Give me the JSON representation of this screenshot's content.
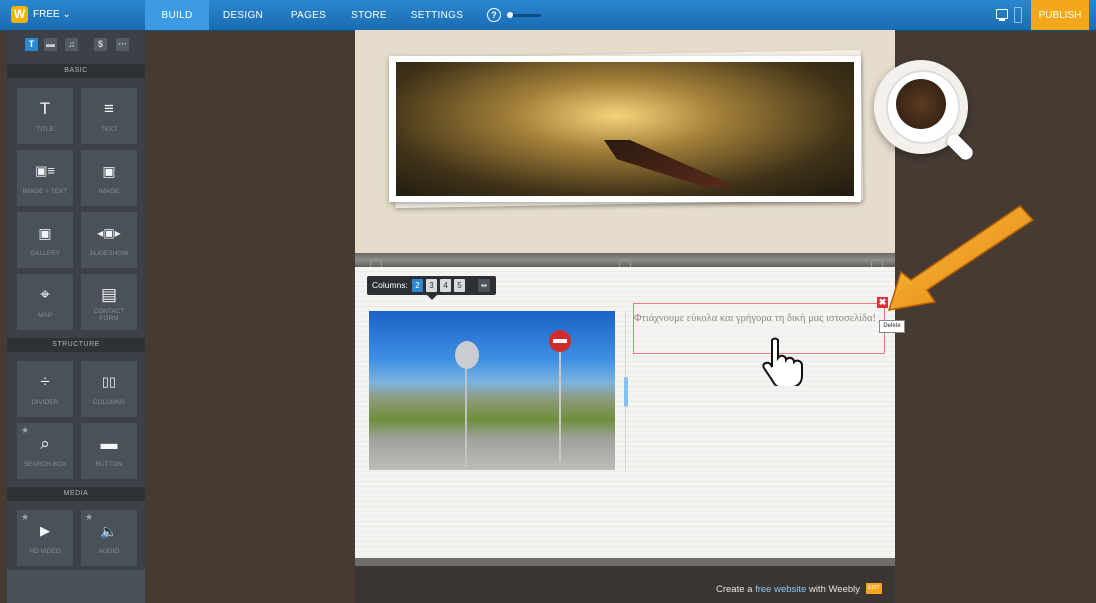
{
  "topbar": {
    "logo": "W",
    "plan": "FREE ⌄",
    "nav": [
      "BUILD",
      "DESIGN",
      "PAGES",
      "STORE",
      "SETTINGS"
    ],
    "help": "?",
    "publish": "PUBLISH"
  },
  "sidebar": {
    "tabs": [
      "T",
      "▬",
      "♫",
      "$",
      "···"
    ],
    "sections": {
      "basic": "BASIC",
      "structure": "STRUCTURE",
      "media": "MEDIA"
    },
    "basic_items": [
      {
        "label": "TITLE",
        "glyph": "T"
      },
      {
        "label": "TEXT",
        "glyph": "≡"
      },
      {
        "label": "IMAGE + TEXT",
        "glyph": "▣≡"
      },
      {
        "label": "IMAGE",
        "glyph": "▣"
      },
      {
        "label": "GALLERY",
        "glyph": "▣"
      },
      {
        "label": "SLIDESHOW",
        "glyph": "◂▣▸"
      },
      {
        "label": "MAP",
        "glyph": "⌖"
      },
      {
        "label": "CONTACT FORM",
        "glyph": "▤"
      }
    ],
    "structure_items": [
      {
        "label": "DIVIDER",
        "glyph": "÷"
      },
      {
        "label": "COLUMNS",
        "glyph": "▯▯"
      },
      {
        "label": "SEARCH BOX",
        "glyph": "⌕"
      },
      {
        "label": "BUTTON",
        "glyph": "▬"
      }
    ],
    "media_items": [
      {
        "label": "HD VIDEO",
        "glyph": "▶"
      },
      {
        "label": "AUDIO",
        "glyph": "🔈"
      }
    ]
  },
  "editor": {
    "columns_label": "Columns:",
    "column_options": [
      "2",
      "3",
      "4",
      "5"
    ],
    "column_toggle": "⇹",
    "paragraph": "Φτιάχνουμε εύκολα και γρήγορα τη δική μας ιστοσελίδα!",
    "delete_icon": "✖",
    "delete_tooltip": "Delete"
  },
  "footer": {
    "prefix": "Create a ",
    "link": "free website",
    "suffix": " with Weebly",
    "badge": "EDIT"
  },
  "colors": {
    "topbar": "#1f78c0",
    "publish": "#f5a71b",
    "selection_border": "#f07a7a",
    "arrow": "#f39a10"
  }
}
